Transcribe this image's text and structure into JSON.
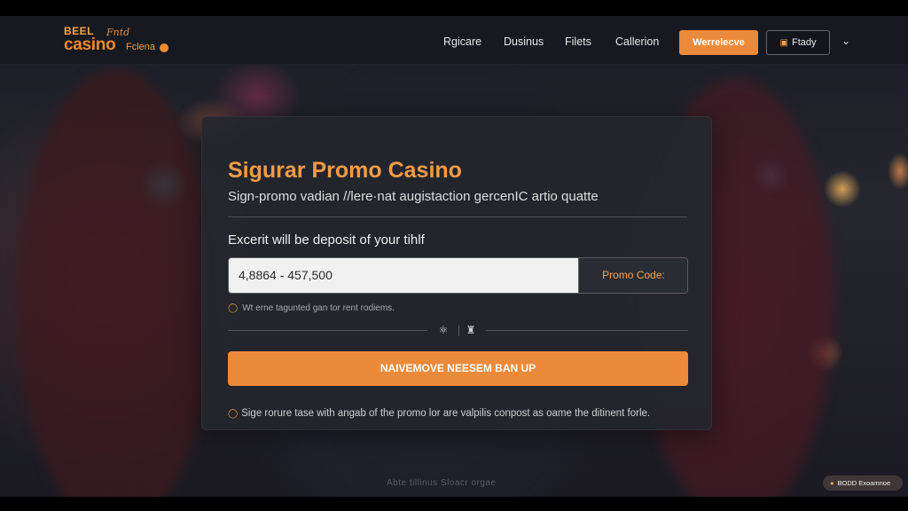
{
  "brand": {
    "top": "BEEL",
    "main": "casino",
    "script": "Fntd",
    "sub": "Fclena"
  },
  "nav": {
    "items": [
      "Rgicare",
      "Dusinus",
      "Filets",
      "Callerion"
    ],
    "primary_button": "Werrelecve",
    "secondary_button": "Ftady"
  },
  "card": {
    "title": "Sigurar Promo Casino",
    "subtitle": "Sign-promo vadian //lere·nat augistaction gercenIC artio quatte",
    "field_label": "Excerit will be deposit of your tihlf",
    "input_value": "4,8864 - 457,500",
    "promo_button": "Promo Code:",
    "hint": "Wt erne tagunted gan tor rent rodiems.",
    "cta": "NAIVEMOVE NEESEM BAN UP",
    "footnote": "Sige rorure tase with angab of the promo lor are valpilis conpost as oame the ditinent forle."
  },
  "footer": {
    "faint_text": "Abte tillinus   Sloacr   orgae",
    "pill": "BODD Exoamnoe"
  },
  "colors": {
    "accent": "#ec8a3b",
    "title": "#f39b45",
    "card_bg": "#24262d",
    "header_bg": "#161920"
  }
}
